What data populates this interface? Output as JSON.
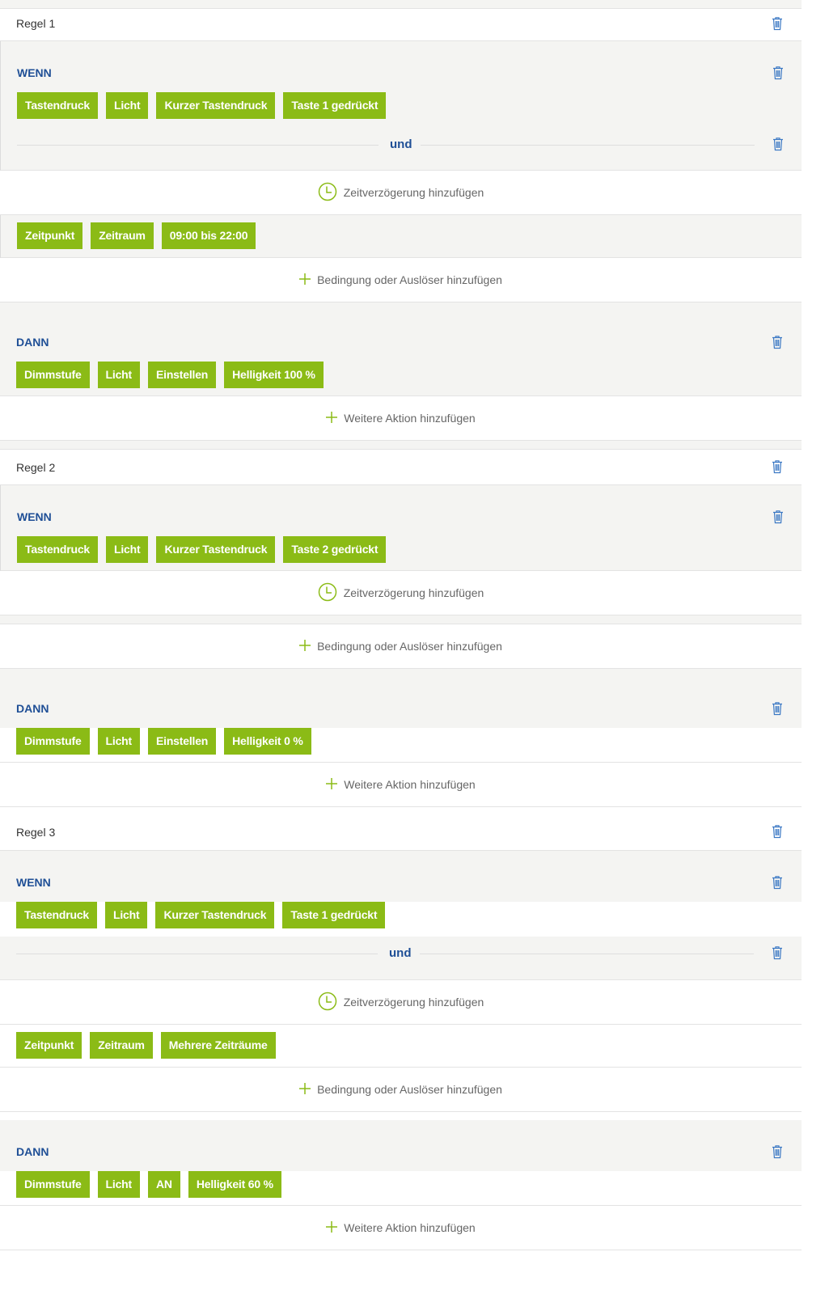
{
  "colors": {
    "chip": "#8bbb16",
    "label": "#1f4f96",
    "trash": "#3b78c4",
    "add": "#8bbb16"
  },
  "rules": [
    {
      "title": "Regel 1",
      "wenn_label": "WENN",
      "wenn_chips": [
        "Tastendruck",
        "Licht",
        "Kurzer Tastendruck",
        "Taste 1 gedrückt"
      ],
      "und_label": "und",
      "delay_label": "Zeitverzögerung hinzufügen",
      "condition_chips": [
        "Zeitpunkt",
        "Zeitraum",
        "09:00 bis 22:00"
      ],
      "add_condition_label": "Bedingung oder Auslöser hinzufügen",
      "dann_label": "DANN",
      "dann_chips": [
        "Dimmstufe",
        "Licht",
        "Einstellen",
        "Helligkeit 100 %"
      ],
      "add_action_label": "Weitere Aktion hinzufügen"
    },
    {
      "title": "Regel 2",
      "wenn_label": "WENN",
      "wenn_chips": [
        "Tastendruck",
        "Licht",
        "Kurzer Tastendruck",
        "Taste 2 gedrückt"
      ],
      "delay_label": "Zeitverzögerung hinzufügen",
      "add_condition_label": "Bedingung oder Auslöser hinzufügen",
      "dann_label": "DANN",
      "dann_chips": [
        "Dimmstufe",
        "Licht",
        "Einstellen",
        "Helligkeit 0 %"
      ],
      "add_action_label": "Weitere Aktion hinzufügen"
    },
    {
      "title": "Regel 3",
      "wenn_label": "WENN",
      "wenn_chips": [
        "Tastendruck",
        "Licht",
        "Kurzer Tastendruck",
        "Taste 1 gedrückt"
      ],
      "und_label": "und",
      "delay_label": "Zeitverzögerung hinzufügen",
      "condition_chips": [
        "Zeitpunkt",
        "Zeitraum",
        "Mehrere Zeiträume"
      ],
      "add_condition_label": "Bedingung oder Auslöser hinzufügen",
      "dann_label": "DANN",
      "dann_chips": [
        "Dimmstufe",
        "Licht",
        "AN",
        "Helligkeit 60 %"
      ],
      "add_action_label": "Weitere Aktion hinzufügen"
    }
  ]
}
